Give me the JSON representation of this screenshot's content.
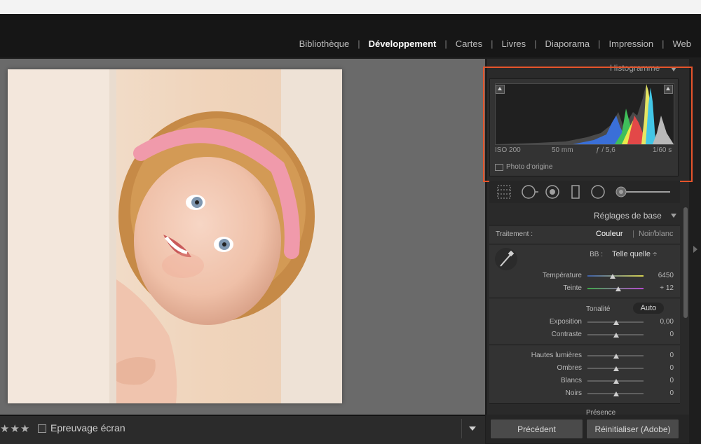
{
  "modules": [
    "Bibliothèque",
    "Développement",
    "Cartes",
    "Livres",
    "Diaporama",
    "Impression",
    "Web"
  ],
  "active_module": "Développement",
  "histogram": {
    "title": "Histogramme",
    "exif": {
      "iso": "ISO 200",
      "focal": "50 mm",
      "aperture": "ƒ / 5,6",
      "shutter": "1/60 s"
    },
    "origin_label": "Photo d'origine"
  },
  "basic": {
    "title": "Réglages de base",
    "treatment_label": "Traitement :",
    "treatment_color": "Couleur",
    "treatment_bw": "Noir/blanc",
    "wb_label": "BB :",
    "wb_value": "Telle quelle ÷",
    "temperature_label": "Température",
    "temperature_value": "6450",
    "tint_label": "Teinte",
    "tint_value": "+ 12",
    "tone_label": "Tonalité",
    "auto_label": "Auto",
    "exposure_label": "Exposition",
    "exposure_value": "0,00",
    "contrast_label": "Contraste",
    "contrast_value": "0",
    "highlights_label": "Hautes lumières",
    "highlights_value": "0",
    "shadows_label": "Ombres",
    "shadows_value": "0",
    "whites_label": "Blancs",
    "whites_value": "0",
    "blacks_label": "Noirs",
    "blacks_value": "0",
    "presence_label": "Présence"
  },
  "toolbar": {
    "stars": "★★★",
    "proof_label": "Epreuvage écran"
  },
  "buttons": {
    "previous": "Précédent",
    "reset": "Réinitialiser (Adobe)"
  },
  "colors": {
    "highlight_border": "#e5542b",
    "panel_bg": "#333333"
  }
}
